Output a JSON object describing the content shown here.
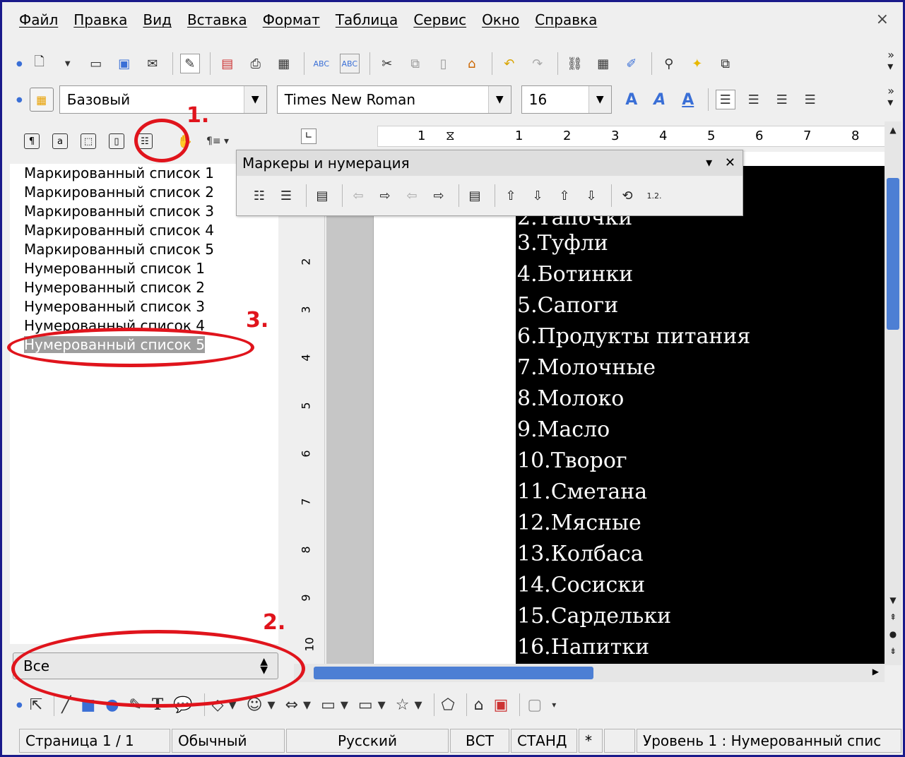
{
  "menu": {
    "items": [
      "Файл",
      "Правка",
      "Вид",
      "Вставка",
      "Формат",
      "Таблица",
      "Сервис",
      "Окно",
      "Справка"
    ],
    "close": "×"
  },
  "formatting": {
    "paragraph_style": "Базовый",
    "font_name": "Times New Roman",
    "font_size": "16"
  },
  "styles_panel": {
    "items": [
      "Маркированный список 1",
      "Маркированный список 2",
      "Маркированный список 3",
      "Маркированный список 4",
      "Маркированный список 5",
      "Нумерованный список 1",
      "Нумерованный список 2",
      "Нумерованный список 3",
      "Нумерованный список 4",
      "Нумерованный список 5"
    ],
    "selected_index": 9,
    "filter": "Все"
  },
  "bullets_toolbar": {
    "title": "Маркеры и нумерация"
  },
  "ruler": {
    "h_numbers": [
      "1",
      "1",
      "2",
      "3",
      "4",
      "5",
      "6",
      "7",
      "8"
    ],
    "v_numbers": [
      "2",
      "3",
      "4",
      "5",
      "6",
      "7",
      "8",
      "9",
      "10"
    ]
  },
  "document": {
    "partial_line": "2.Тапочки",
    "lines": [
      "3.Туфли",
      "4.Ботинки",
      "5.Сапоги",
      "6.Продукты питания",
      "7.Молочные",
      "8.Молоко",
      "9.Масло",
      "10.Творог",
      "11.Сметана",
      "12.Мясные",
      "13.Колбаса",
      "14.Сосиски",
      "15.Сардельки",
      "16.Напитки"
    ]
  },
  "annotations": [
    "1.",
    "2.",
    "3."
  ],
  "statusbar": {
    "page": "Страница  1 / 1",
    "page_style": "Обычный",
    "language": "Русский",
    "insert_mode": "ВСТ",
    "selection_mode": "СТАНД",
    "modified": "*",
    "level": "Уровень  1 : Нумерованный спис"
  },
  "colors": {
    "annotation": "#e0141c",
    "scroll_thumb": "#4d7fd4",
    "window_border": "#1a1a8a"
  }
}
